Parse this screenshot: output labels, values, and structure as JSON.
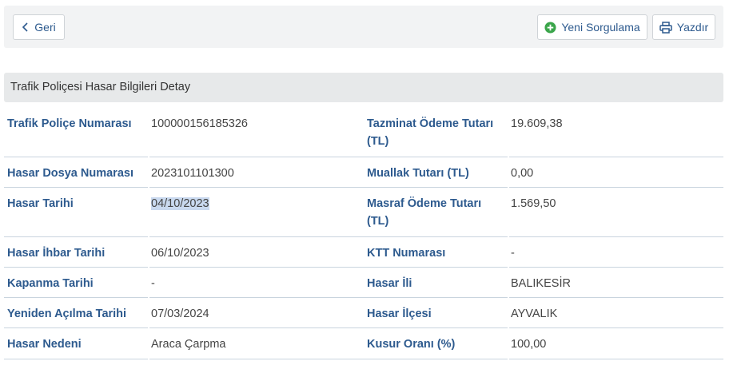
{
  "toolbar": {
    "back_label": "Geri",
    "new_query_label": "Yeni Sorgulama",
    "print_label": "Yazdır",
    "icons": [
      "chevron-left-icon",
      "plus-circle-icon",
      "printer-icon"
    ],
    "accent_green": "#3aa54a",
    "accent_blue": "#2d5a8e"
  },
  "panel": {
    "title": "Trafik Poliçesi Hasar Bilgileri Detay"
  },
  "rows": [
    {
      "label1": "Trafik Poliçe Numarası",
      "value1": "100000156185326",
      "label2": "Tazminat Ödeme Tutarı (TL)",
      "value2": "19.609,38"
    },
    {
      "label1": "Hasar Dosya Numarası",
      "value1": "2023101101300",
      "label2": "Muallak Tutarı (TL)",
      "value2": "0,00"
    },
    {
      "label1": "Hasar Tarihi",
      "value1": "04/10/2023",
      "label2": "Masraf Ödeme Tutarı (TL)",
      "value2": "1.569,50"
    },
    {
      "label1": "Hasar İhbar Tarihi",
      "value1": "06/10/2023",
      "label2": "KTT Numarası",
      "value2": "-"
    },
    {
      "label1": "Kapanma Tarihi",
      "value1": "-",
      "label2": "Hasar İli",
      "value2": "BALIKESİR"
    },
    {
      "label1": "Yeniden Açılma Tarihi",
      "value1": "07/03/2024",
      "label2": "Hasar İlçesi",
      "value2": "AYVALIK"
    },
    {
      "label1": "Hasar Nedeni",
      "value1": "Araca Çarpma",
      "label2": "Kusur Oranı (%)",
      "value2": "100,00"
    }
  ]
}
